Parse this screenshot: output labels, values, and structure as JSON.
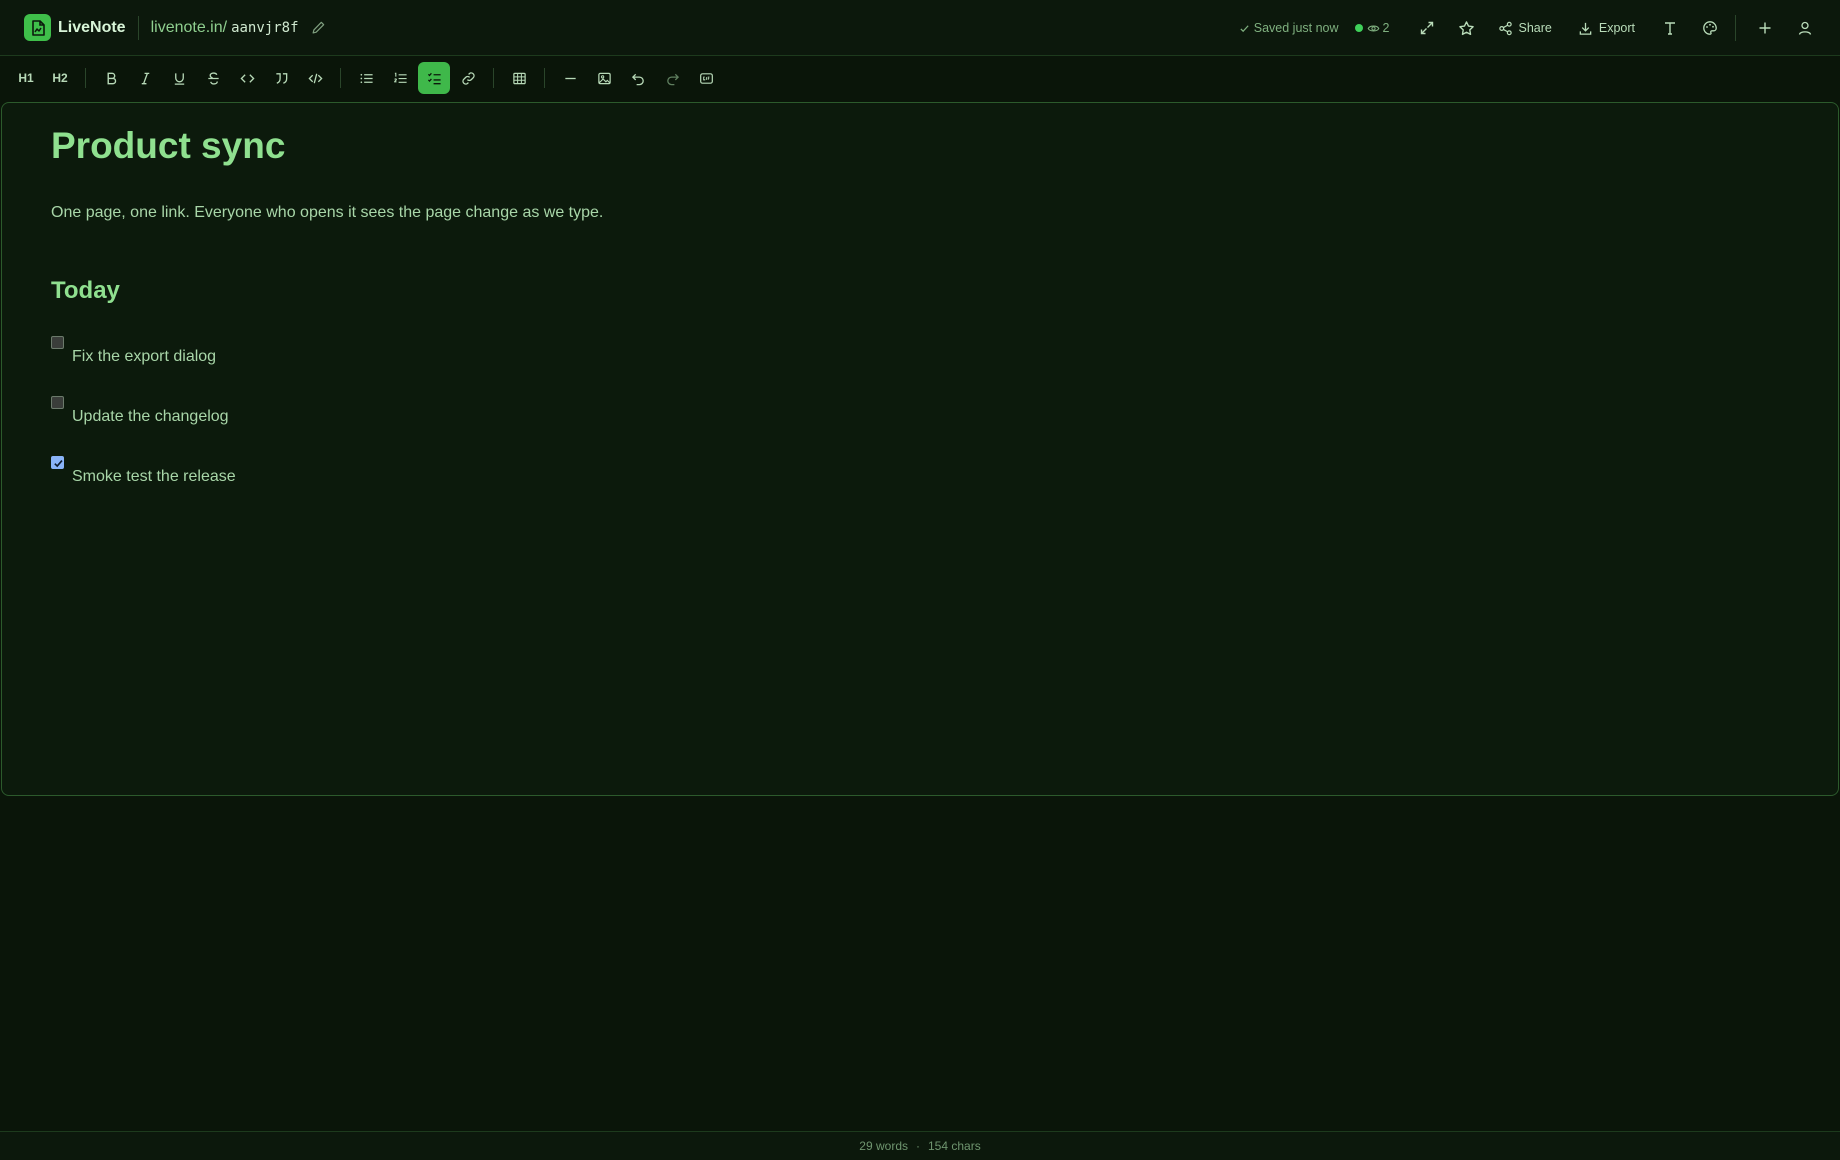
{
  "app": {
    "name": "LiveNote",
    "url_prefix": "livenote.in/",
    "url_slug": "aanvjr8f"
  },
  "header": {
    "save_status": "Saved just now",
    "viewer_count": "2",
    "share_label": "Share",
    "export_label": "Export",
    "icons": [
      "expand-icon",
      "star-icon",
      "share-icon",
      "download-icon",
      "font-icon",
      "palette-icon",
      "plus-icon",
      "user-icon"
    ]
  },
  "toolbar": {
    "h1_label": "H1",
    "h2_label": "H2",
    "active_tool": "task-list",
    "tools": [
      "h1",
      "h2",
      "bold",
      "italic",
      "underline",
      "strikethrough",
      "inline-code",
      "blockquote",
      "code-block",
      "bullet-list",
      "numbered-list",
      "task-list",
      "link",
      "table",
      "horizontal-rule",
      "image",
      "undo",
      "redo",
      "gif"
    ]
  },
  "document": {
    "title": "Product sync",
    "intro": "One page, one link. Everyone who opens it sees the page change as we type.",
    "section_heading": "Today",
    "tasks": [
      {
        "label": "Fix the export dialog",
        "checked": false
      },
      {
        "label": "Update the changelog",
        "checked": false
      },
      {
        "label": "Smoke test the release",
        "checked": true
      }
    ]
  },
  "status": {
    "words": "29 words",
    "chars": "154 chars",
    "separator": "·"
  },
  "colors": {
    "background": "#0a1509",
    "accent": "#3fb84a",
    "heading": "#8fe08f",
    "text": "#a8d6a8"
  }
}
